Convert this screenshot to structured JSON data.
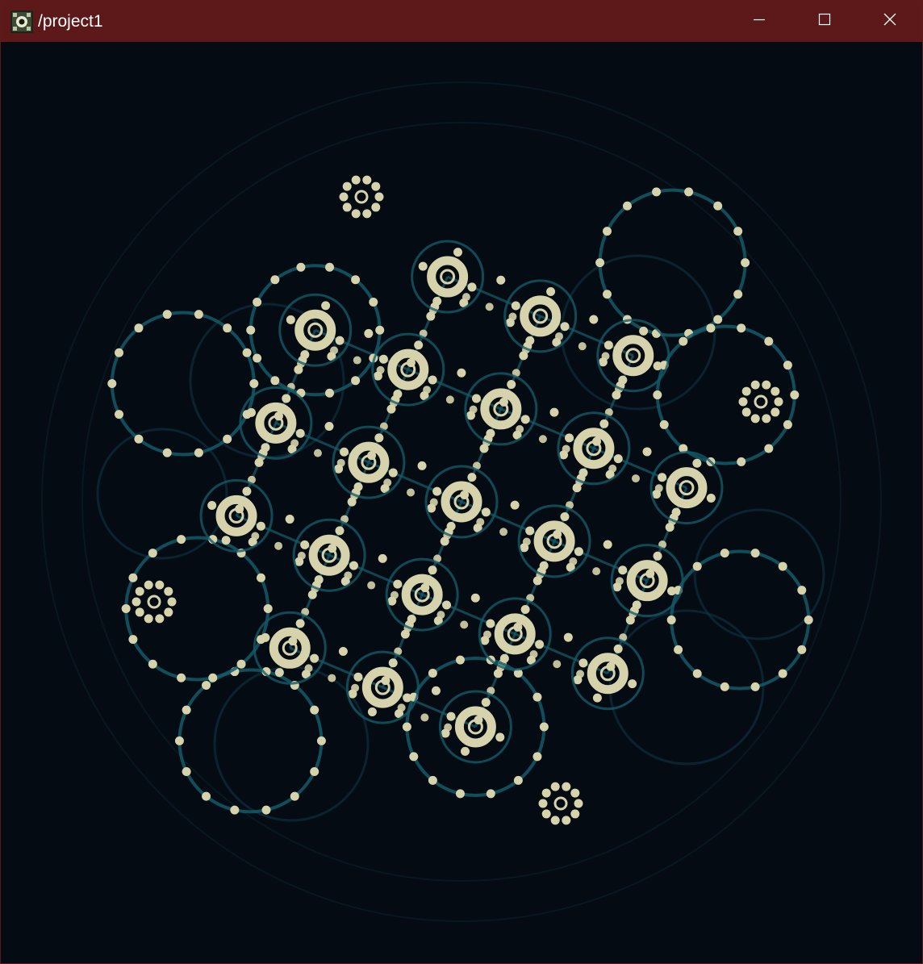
{
  "window": {
    "title": "/project1",
    "app_icon": "settings-app-icon",
    "controls": {
      "minimize_icon": "minimize-icon",
      "maximize_icon": "maximize-icon",
      "close_icon": "close-icon"
    },
    "colors": {
      "titlebar": "#5d191a",
      "background": "#040b12",
      "line": "#135a68",
      "dot": "#d6d2ab"
    }
  }
}
